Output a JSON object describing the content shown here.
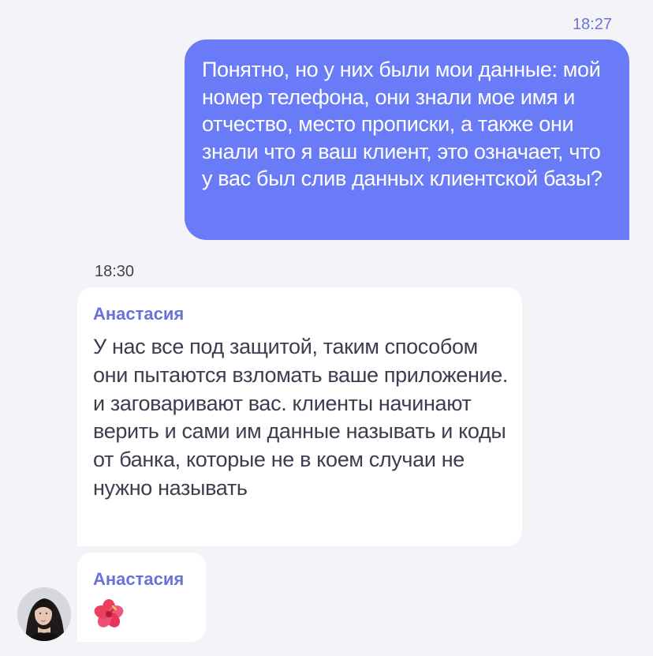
{
  "chat": {
    "outgoing": {
      "time": "18:27",
      "text": "Понятно, но у них были мои данные: мой номер телефона, они знали мое имя и отчество, место прописки, а также они знали что я ваш клиент, это означает, что у вас был слив данных клиентской базы?"
    },
    "incoming": {
      "time": "18:30",
      "messages": [
        {
          "sender": "Анастасия",
          "text": "У нас все под защитой, таким способом они пытаются взломать ваше приложение. и заговаривают вас. клиенты начинают верить и сами им данные называть и коды от банка, которые не в коем случаи не нужно называть"
        },
        {
          "sender": "Анастасия",
          "emoji": "hibiscus-flower"
        }
      ]
    },
    "colors": {
      "outgoing_bubble": "#6a7bf7",
      "sender_name": "#6872d8",
      "background": "#f4f4f8"
    }
  }
}
